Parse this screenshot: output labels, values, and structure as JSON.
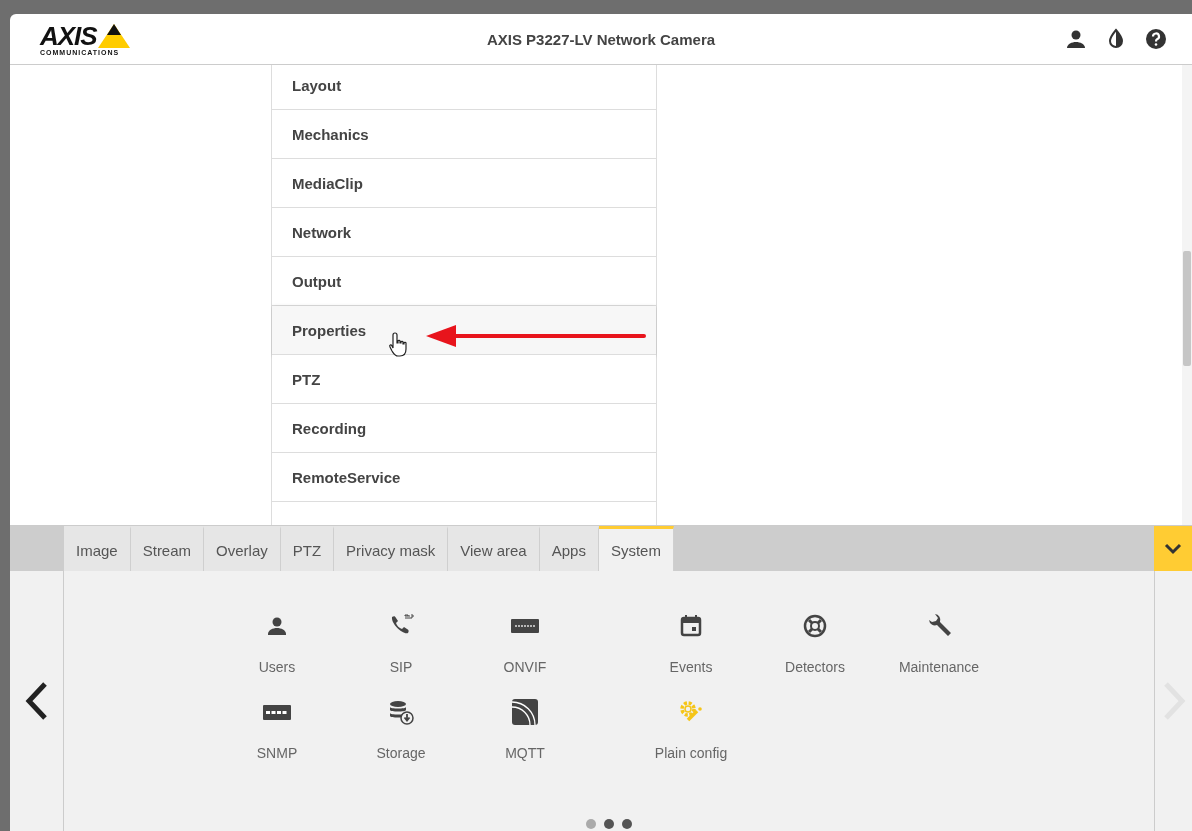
{
  "header": {
    "logo": {
      "name": "AXIS",
      "tagline": "COMMUNICATIONS"
    },
    "title": "AXIS P3227-LV Network Camera"
  },
  "list": {
    "items": [
      {
        "label": "Layout",
        "hovered": false
      },
      {
        "label": "Mechanics",
        "hovered": false
      },
      {
        "label": "MediaClip",
        "hovered": false
      },
      {
        "label": "Network",
        "hovered": false
      },
      {
        "label": "Output",
        "hovered": false
      },
      {
        "label": "Properties",
        "hovered": true
      },
      {
        "label": "PTZ",
        "hovered": false
      },
      {
        "label": "Recording",
        "hovered": false
      },
      {
        "label": "RemoteService",
        "hovered": false
      }
    ]
  },
  "tabs": [
    {
      "label": "Image",
      "selected": false
    },
    {
      "label": "Stream",
      "selected": false
    },
    {
      "label": "Overlay",
      "selected": false
    },
    {
      "label": "PTZ",
      "selected": false
    },
    {
      "label": "Privacy mask",
      "selected": false
    },
    {
      "label": "View area",
      "selected": false
    },
    {
      "label": "Apps",
      "selected": false
    },
    {
      "label": "System",
      "selected": true
    }
  ],
  "panel": {
    "groups": [
      {
        "items": [
          {
            "label": "Users",
            "kind": "user",
            "highlighted": false
          },
          {
            "label": "SIP",
            "kind": "sip",
            "highlighted": false
          },
          {
            "label": "ONVIF",
            "kind": "onvif",
            "highlighted": false
          },
          {
            "label": "SNMP",
            "kind": "snmp",
            "highlighted": false
          },
          {
            "label": "Storage",
            "kind": "storage",
            "highlighted": false
          },
          {
            "label": "MQTT",
            "kind": "mqtt",
            "highlighted": false
          }
        ]
      },
      {
        "items": [
          {
            "label": "Events",
            "kind": "events",
            "highlighted": false
          },
          {
            "label": "Detectors",
            "kind": "detectors",
            "highlighted": false
          },
          {
            "label": "Maintenance",
            "kind": "maintenance",
            "highlighted": false
          },
          {
            "label": "Plain config",
            "kind": "plainconfig",
            "highlighted": true
          }
        ]
      }
    ],
    "next_disabled": true,
    "dots": [
      {
        "selected": false
      },
      {
        "selected": true
      },
      {
        "selected": true
      }
    ]
  }
}
